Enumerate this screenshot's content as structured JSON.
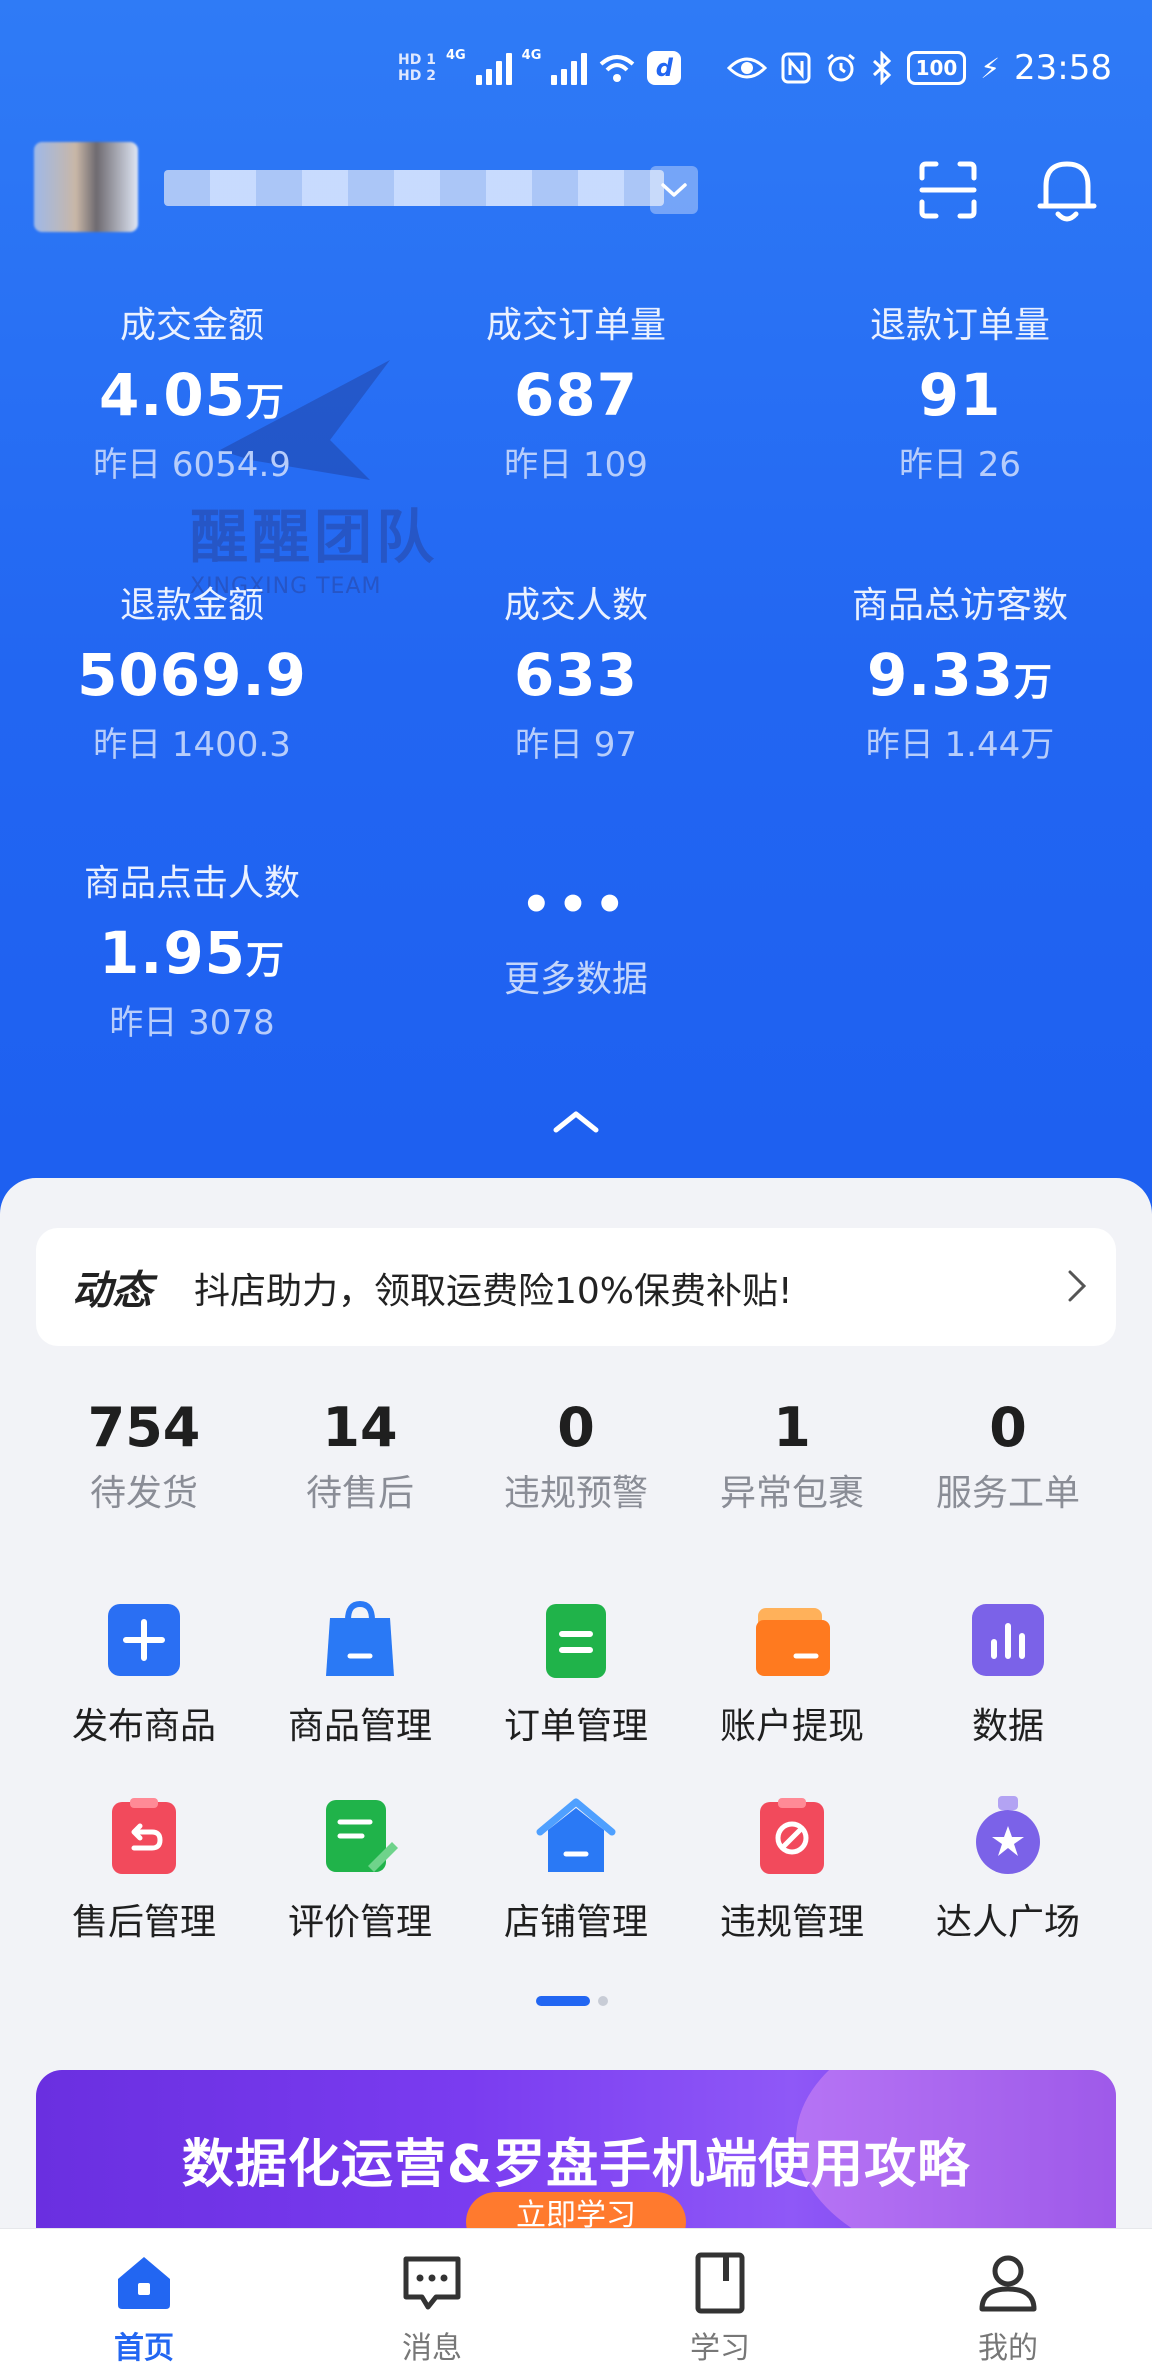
{
  "status_bar": {
    "hd1": "HD 1",
    "hd2": "HD 2",
    "net1": "4G",
    "net2": "4G",
    "battery": "100",
    "time": "23:58"
  },
  "header": {
    "shop_name": "",
    "icons": [
      "chevron-down-icon",
      "scan-icon",
      "bell-icon"
    ]
  },
  "stats": [
    {
      "label": "成交金额",
      "value": "4.05",
      "unit": "万",
      "prev": "昨日 6054.9"
    },
    {
      "label": "成交订单量",
      "value": "687",
      "unit": "",
      "prev": "昨日 109"
    },
    {
      "label": "退款订单量",
      "value": "91",
      "unit": "",
      "prev": "昨日 26"
    },
    {
      "label": "退款金额",
      "value": "5069.9",
      "unit": "",
      "prev": "昨日 1400.3"
    },
    {
      "label": "成交人数",
      "value": "633",
      "unit": "",
      "prev": "昨日 97"
    },
    {
      "label": "商品总访客数",
      "value": "9.33",
      "unit": "万",
      "prev": "昨日 1.44万"
    },
    {
      "label": "商品点击人数",
      "value": "1.95",
      "unit": "万",
      "prev": "昨日 3078"
    }
  ],
  "more": {
    "dots": "•••",
    "label": "更多数据"
  },
  "watermark": {
    "main": "醒醒团队",
    "sub": "XINGXING TEAM"
  },
  "notice": {
    "tag": "动态",
    "text": "抖店助力，领取运费险10%保费补贴!"
  },
  "counts": [
    {
      "num": "754",
      "label": "待发货"
    },
    {
      "num": "14",
      "label": "待售后"
    },
    {
      "num": "0",
      "label": "违规预警"
    },
    {
      "num": "1",
      "label": "异常包裹"
    },
    {
      "num": "0",
      "label": "服务工单"
    }
  ],
  "grid": [
    {
      "label": "发布商品",
      "icon": "plus-icon",
      "color": "#2a6ff3"
    },
    {
      "label": "商品管理",
      "icon": "shopping-bag-icon",
      "color": "#2a79f5"
    },
    {
      "label": "订单管理",
      "icon": "order-list-icon",
      "color": "#20b34a"
    },
    {
      "label": "账户提现",
      "icon": "wallet-icon",
      "color": "#ff7a1f"
    },
    {
      "label": "数据",
      "icon": "bar-chart-icon",
      "color": "#7b62e8"
    },
    {
      "label": "售后管理",
      "icon": "return-icon",
      "color": "#f24a5c"
    },
    {
      "label": "评价管理",
      "icon": "review-icon",
      "color": "#20b34a"
    },
    {
      "label": "店铺管理",
      "icon": "store-icon",
      "color": "#2a79f5"
    },
    {
      "label": "违规管理",
      "icon": "violation-icon",
      "color": "#f24a5c"
    },
    {
      "label": "达人广场",
      "icon": "star-medal-icon",
      "color": "#7b62e8"
    }
  ],
  "banner": {
    "title": "数据化运营&罗盘手机端使用攻略",
    "button": "立即学习"
  },
  "tabs": [
    {
      "label": "首页",
      "icon": "home-icon",
      "active": true
    },
    {
      "label": "消息",
      "icon": "message-icon",
      "active": false
    },
    {
      "label": "学习",
      "icon": "book-icon",
      "active": false
    },
    {
      "label": "我的",
      "icon": "profile-icon",
      "active": false
    }
  ],
  "colors": {
    "primary": "#2266f2",
    "background": "#f2f3f7"
  }
}
